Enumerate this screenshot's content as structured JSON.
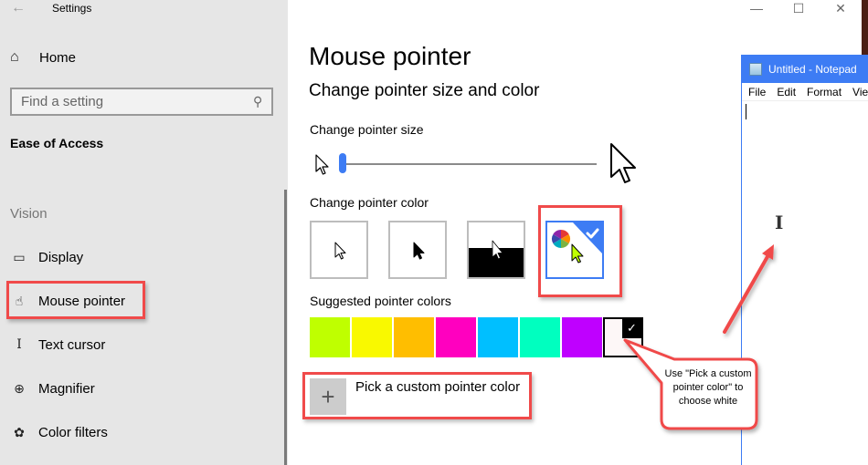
{
  "window": {
    "title": "Settings",
    "back_icon": "back-arrow-icon",
    "controls": {
      "minimize": "—",
      "maximize": "☐",
      "close": "✕"
    }
  },
  "sidebar": {
    "home_label": "Home",
    "search_placeholder": "Find a setting",
    "section_title": "Ease of Access",
    "group_label": "Vision",
    "items": [
      {
        "label": "Display",
        "icon": "monitor-icon"
      },
      {
        "label": "Mouse pointer",
        "icon": "mouse-pointer-icon",
        "selected": true
      },
      {
        "label": "Text cursor",
        "icon": "text-cursor-icon"
      },
      {
        "label": "Magnifier",
        "icon": "magnifier-icon"
      },
      {
        "label": "Color filters",
        "icon": "palette-icon"
      }
    ]
  },
  "main": {
    "title": "Mouse pointer",
    "subtitle": "Change pointer size and color",
    "size_label": "Change pointer size",
    "pointer_size_value": 1,
    "pointer_size_fraction": 0,
    "color_label": "Change pointer color",
    "color_options": [
      {
        "name": "white",
        "selected": false
      },
      {
        "name": "black",
        "selected": false
      },
      {
        "name": "inverted",
        "selected": false
      },
      {
        "name": "custom",
        "selected": true
      }
    ],
    "suggested_label": "Suggested pointer colors",
    "suggested_colors": [
      "#bfff00",
      "#f9f900",
      "#ffbe00",
      "#ff00bf",
      "#00bfff",
      "#00ffbf",
      "#bf00ff"
    ],
    "selected_swatch": {
      "color": "#fdf7f7",
      "check": "✓"
    },
    "custom_button": {
      "icon": "+",
      "label": "Pick a custom pointer color"
    }
  },
  "notepad": {
    "title": "Untitled - Notepad",
    "menu": [
      "File",
      "Edit",
      "Format",
      "View"
    ]
  },
  "annotation": {
    "callout_text": "Use \"Pick a custom pointer color\" to choose white",
    "color": "#f04a4a"
  },
  "colors": {
    "accent": "#3d7cf4",
    "sidebar_bg": "#e6e6e6"
  }
}
